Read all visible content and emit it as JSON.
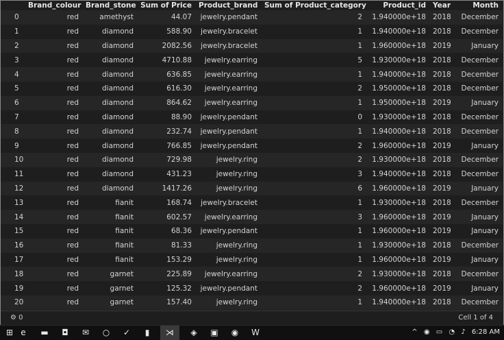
{
  "table": {
    "columns": [
      "",
      "Brand_colour",
      "Brand_stone",
      "Sum of Price",
      "Product_brand",
      "Sum of Product_category",
      "Product_id",
      "Year",
      "Month"
    ],
    "rows": [
      [
        "0",
        "red",
        "amethyst",
        "44.07",
        "jewelry.pendant",
        "2",
        "1.940000e+18",
        "2018",
        "December"
      ],
      [
        "1",
        "red",
        "diamond",
        "588.90",
        "jewelry.bracelet",
        "1",
        "1.940000e+18",
        "2018",
        "December"
      ],
      [
        "2",
        "red",
        "diamond",
        "2082.56",
        "jewelry.bracelet",
        "1",
        "1.960000e+18",
        "2019",
        "January"
      ],
      [
        "3",
        "red",
        "diamond",
        "4710.88",
        "jewelry.earring",
        "5",
        "1.930000e+18",
        "2018",
        "December"
      ],
      [
        "4",
        "red",
        "diamond",
        "636.85",
        "jewelry.earring",
        "1",
        "1.940000e+18",
        "2018",
        "December"
      ],
      [
        "5",
        "red",
        "diamond",
        "616.30",
        "jewelry.earring",
        "2",
        "1.950000e+18",
        "2018",
        "December"
      ],
      [
        "6",
        "red",
        "diamond",
        "864.62",
        "jewelry.earring",
        "1",
        "1.950000e+18",
        "2019",
        "January"
      ],
      [
        "7",
        "red",
        "diamond",
        "88.90",
        "jewelry.pendant",
        "0",
        "1.930000e+18",
        "2018",
        "December"
      ],
      [
        "8",
        "red",
        "diamond",
        "232.74",
        "jewelry.pendant",
        "1",
        "1.940000e+18",
        "2018",
        "December"
      ],
      [
        "9",
        "red",
        "diamond",
        "766.85",
        "jewelry.pendant",
        "2",
        "1.960000e+18",
        "2019",
        "January"
      ],
      [
        "10",
        "red",
        "diamond",
        "729.98",
        "jewelry.ring",
        "2",
        "1.930000e+18",
        "2018",
        "December"
      ],
      [
        "11",
        "red",
        "diamond",
        "431.23",
        "jewelry.ring",
        "3",
        "1.940000e+18",
        "2018",
        "December"
      ],
      [
        "12",
        "red",
        "diamond",
        "1417.26",
        "jewelry.ring",
        "6",
        "1.960000e+18",
        "2019",
        "January"
      ],
      [
        "13",
        "red",
        "fianit",
        "168.74",
        "jewelry.bracelet",
        "1",
        "1.930000e+18",
        "2018",
        "December"
      ],
      [
        "14",
        "red",
        "fianit",
        "602.57",
        "jewelry.earring",
        "3",
        "1.960000e+18",
        "2019",
        "January"
      ],
      [
        "15",
        "red",
        "fianit",
        "68.36",
        "jewelry.pendant",
        "1",
        "1.960000e+18",
        "2019",
        "January"
      ],
      [
        "16",
        "red",
        "fianit",
        "81.33",
        "jewelry.ring",
        "1",
        "1.930000e+18",
        "2018",
        "December"
      ],
      [
        "17",
        "red",
        "fianit",
        "153.29",
        "jewelry.ring",
        "1",
        "1.960000e+18",
        "2019",
        "January"
      ],
      [
        "18",
        "red",
        "garnet",
        "225.89",
        "jewelry.earring",
        "2",
        "1.930000e+18",
        "2018",
        "December"
      ],
      [
        "19",
        "red",
        "garnet",
        "125.32",
        "jewelry.pendant",
        "2",
        "1.960000e+18",
        "2019",
        "January"
      ],
      [
        "20",
        "red",
        "garnet",
        "157.40",
        "jewelry.ring",
        "1",
        "1.940000e+18",
        "2018",
        "December"
      ]
    ]
  },
  "statusbar": {
    "left": "0",
    "right": "Cell 1 of 4"
  },
  "taskbar": {
    "icons": [
      "start-icon",
      "edge-icon",
      "file-explorer-icon",
      "store-icon",
      "mail-icon",
      "app-icon",
      "check-app-icon",
      "notes-icon",
      "vscode-icon",
      "cube-icon",
      "pc-icon",
      "photos-icon",
      "word-icon"
    ],
    "clock": "6:28 AM"
  }
}
